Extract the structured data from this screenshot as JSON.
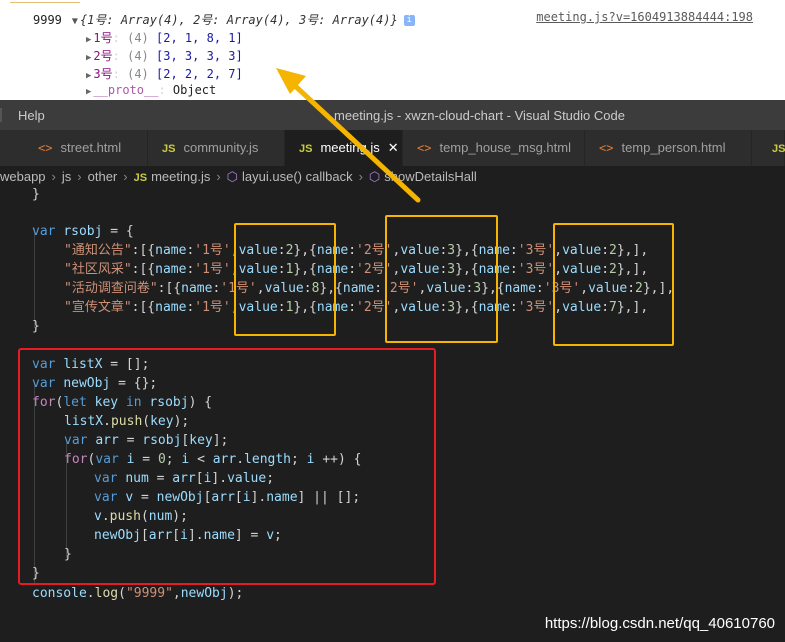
{
  "console": {
    "log_number": "9999",
    "object_summary": "{1号: Array(4), 2号: Array(4), 3号: Array(4)}",
    "info_badge": "i",
    "source_link": "meeting.js?v=1604913884444:198",
    "items": [
      {
        "key": "1号",
        "len": "(4)",
        "value": "[2, 1, 8, 1]"
      },
      {
        "key": "2号",
        "len": "(4)",
        "value": "[3, 3, 3, 3]"
      },
      {
        "key": "3号",
        "len": "(4)",
        "value": "[2, 2, 2, 7]"
      }
    ],
    "proto_key": "__proto__",
    "proto_value": "Object"
  },
  "titlebar": {
    "help_menu": "Help",
    "window_title": "meeting.js - xwzn-cloud-chart - Visual Studio Code"
  },
  "tabs": [
    {
      "label": "street.html",
      "icon": "html-icon"
    },
    {
      "label": "community.js",
      "icon": "js-icon"
    },
    {
      "label": "meeting.js",
      "icon": "js-icon",
      "active": true
    },
    {
      "label": "temp_house_msg.html",
      "icon": "html-icon"
    },
    {
      "label": "temp_person.html",
      "icon": "html-icon"
    },
    {
      "label": "JS",
      "icon": "js-icon"
    }
  ],
  "breadcrumb": {
    "items": [
      "webapp",
      "js",
      "other",
      "meeting.js",
      "layui.use() callback",
      "showDetailsHall"
    ]
  },
  "code": {
    "close_brace_top": "}",
    "rsobj_decl": "var rsobj = {",
    "rsobj_rows": [
      {
        "key": "\"通知公告\"",
        "v1": "2",
        "v2": "3",
        "v3": "2"
      },
      {
        "key": "\"社区风采\"",
        "v1": "1",
        "v2": "3",
        "v3": "2"
      },
      {
        "key": "\"活动调查问卷\"",
        "v1": "8",
        "v2": "3",
        "v3": "2"
      },
      {
        "key": "\"宣传文章\"",
        "v1": "1",
        "v2": "3",
        "v3": "7"
      }
    ],
    "names": [
      "'1号'",
      "'2号'",
      "'3号'"
    ],
    "close_brace_obj": "}",
    "console_log_label": "\"9999\""
  },
  "watermark": "https://blog.csdn.net/qq_40610760",
  "colors": {
    "highlight_box": "#f5b400",
    "block_box": "#e51c23",
    "arrow": "#f5b400"
  }
}
